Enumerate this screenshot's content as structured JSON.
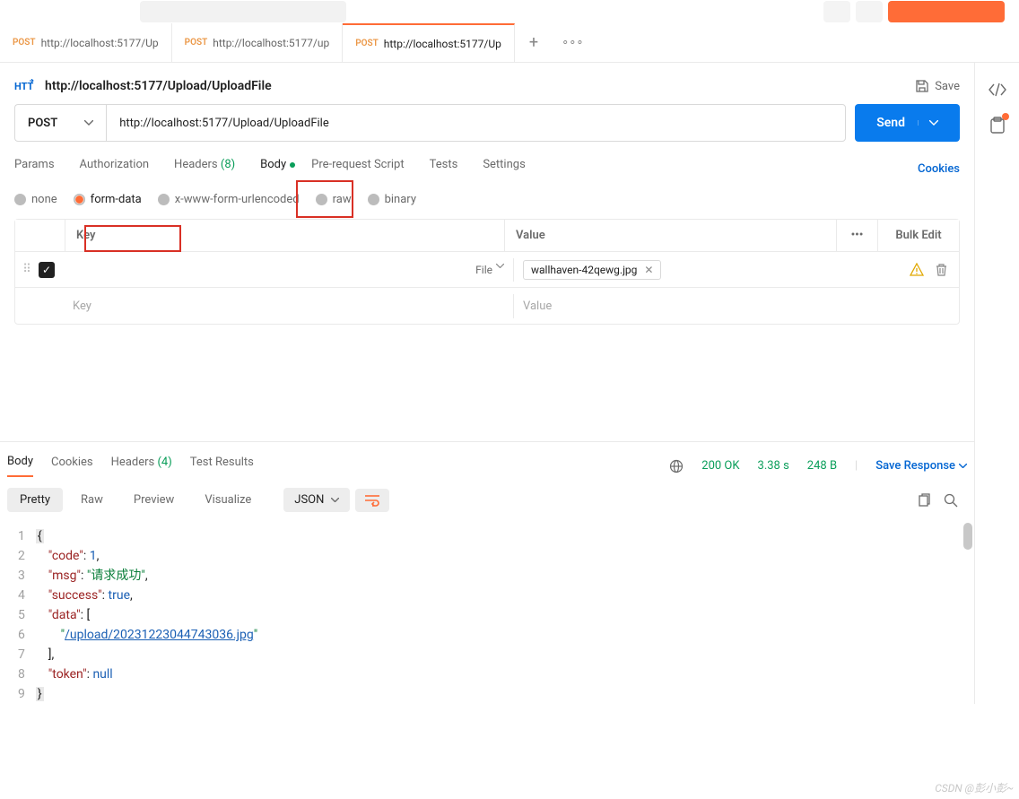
{
  "topTabs": [
    {
      "method": "POST",
      "label": "http://localhost:5177/Up"
    },
    {
      "method": "POST",
      "label": "http://localhost:5177/up"
    },
    {
      "method": "POST",
      "label": "http://localhost:5177/Up"
    }
  ],
  "request": {
    "title": "http://localhost:5177/Upload/UploadFile",
    "method": "POST",
    "url": "http://localhost:5177/Upload/UploadFile",
    "saveLabel": "Save",
    "sendLabel": "Send"
  },
  "reqTabs": {
    "params": "Params",
    "auth": "Authorization",
    "headersLabel": "Headers",
    "headersCount": "(8)",
    "body": "Body",
    "prereq": "Pre-request Script",
    "tests": "Tests",
    "settings": "Settings",
    "cookies": "Cookies"
  },
  "bodyTypes": {
    "none": "none",
    "formdata": "form-data",
    "xwww": "x-www-form-urlencoded",
    "raw": "raw",
    "binary": "binary"
  },
  "kvTable": {
    "keyHeader": "Key",
    "valueHeader": "Value",
    "bulkEdit": "Bulk Edit",
    "fileTypeLabel": "File",
    "row0": {
      "file": "wallhaven-42qewg.jpg"
    },
    "emptyKey": "Key",
    "emptyValue": "Value"
  },
  "respTabs": {
    "body": "Body",
    "cookies": "Cookies",
    "headersLabel": "Headers",
    "headersCount": "(4)",
    "testResults": "Test Results"
  },
  "respMeta": {
    "status": "200 OK",
    "time": "3.38 s",
    "size": "248 B",
    "saveResp": "Save Response"
  },
  "respView": {
    "pretty": "Pretty",
    "raw": "Raw",
    "preview": "Preview",
    "visualize": "Visualize",
    "format": "JSON"
  },
  "respBody": {
    "code": 1,
    "msg": "请求成功",
    "success": "true",
    "dataPath": "/upload/20231223044743036.jpg",
    "token": "null"
  },
  "watermark": "CSDN @彭小彭~"
}
